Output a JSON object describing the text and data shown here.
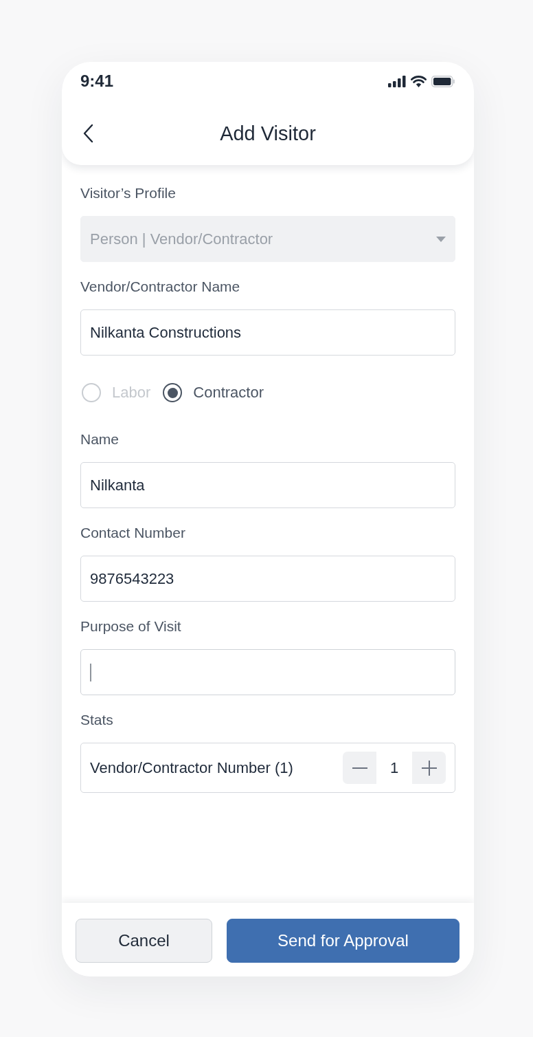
{
  "status_bar": {
    "time": "9:41"
  },
  "header": {
    "title": "Add Visitor"
  },
  "form": {
    "fields": [
      {
        "kind": "select",
        "label": "Visitor’s Profile",
        "value": "Person | Vendor/Contractor",
        "disabled": true
      },
      {
        "kind": "text",
        "label": "Vendor/Contractor Name",
        "value": "Nilkanta Constructions",
        "focused": false
      },
      {
        "kind": "radio",
        "options": [
          {
            "label": "Labor",
            "selected": false,
            "disabled": true
          },
          {
            "label": "Contractor",
            "selected": true,
            "disabled": false
          }
        ]
      },
      {
        "kind": "text",
        "label": "Name",
        "value": "Nilkanta",
        "focused": false
      },
      {
        "kind": "text",
        "label": "Contact Number",
        "value": "9876543223",
        "focused": false
      },
      {
        "kind": "text",
        "label": "Purpose of Visit",
        "focused": true
      },
      {
        "kind": "stepper",
        "label": "Stats",
        "item": "Vendor/Contractor Number (1)",
        "value": "1"
      }
    ]
  },
  "footer": {
    "buttons": [
      {
        "label": "Cancel",
        "kind": "secondary"
      },
      {
        "label": "Send for Approval",
        "kind": "primary"
      }
    ]
  }
}
